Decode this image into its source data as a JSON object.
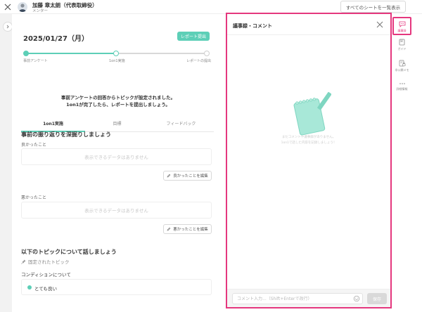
{
  "header": {
    "user_name": "加藤 章太朗（代表取締役）",
    "user_role": "メンター",
    "all_sheets_label": "すべてのシートを一覧表示"
  },
  "main": {
    "date": "2025/01/27（月）",
    "report_button": "レポート提出",
    "steps": [
      "事前アンケート",
      "1on1実施",
      "レポートの提出"
    ],
    "notice_line1": "事前アンケートの回答からトピックが設定されました。",
    "notice_line2": "1on1が完了したら、レポートを提出しましょう。",
    "tabs": [
      "1on1実施",
      "目標",
      "フィードバック"
    ],
    "reflection_title": "事前の振り返りを深掘りしましょう",
    "good_label": "良かったこと",
    "good_empty": "表示できるデータはありません",
    "good_edit": "良かったことを編集",
    "bad_label": "悪かったこと",
    "bad_empty": "表示できるデータはありません",
    "bad_edit": "悪かったことを編集",
    "topics_title": "以下のトピックについて話しましょう",
    "pinned_label": "固定されたトピック",
    "condition_label": "コンディションについて",
    "condition_value": "とても良い"
  },
  "panel": {
    "title": "議事録・コメント",
    "empty_line1": "まだコメントや議事録がありません。",
    "empty_line2": "1on1で話した内容を記録しましょう！",
    "input_placeholder": "コメント入力...（Shift+Enterで改行）",
    "save_label": "保存"
  },
  "sidebar": {
    "items": [
      {
        "label": "議事録",
        "icon": "chat-icon"
      },
      {
        "label": "ガイド",
        "icon": "book-icon"
      },
      {
        "label": "非公開メモ",
        "icon": "lock-memo-icon"
      },
      {
        "label": "詳細情報",
        "icon": "more-icon"
      }
    ]
  },
  "colors": {
    "accent": "#5dcfb7",
    "highlight": "#e5377e"
  }
}
